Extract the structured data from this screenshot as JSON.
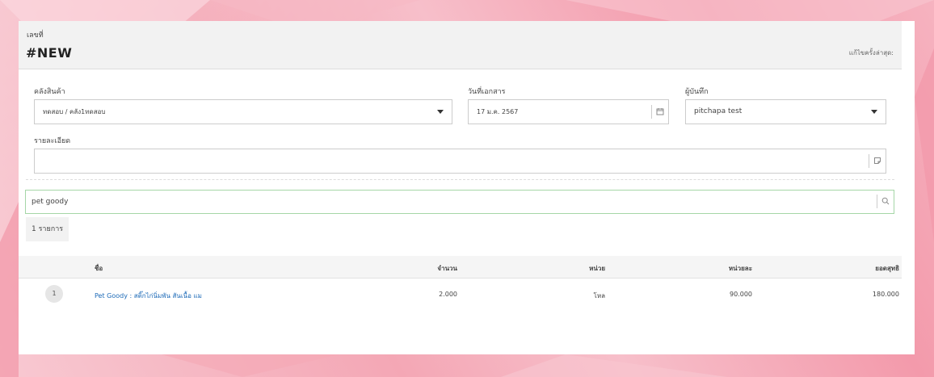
{
  "header": {
    "doc_label": "เลขที่",
    "doc_number": "#NEW",
    "last_edit_label": "แก้ไขครั้งล่าสุด:"
  },
  "form": {
    "warehouse": {
      "label": "คลังสินค้า",
      "value": "ทดสอบ / คลัง1ทดสอบ"
    },
    "doc_date": {
      "label": "วันที่เอกสาร",
      "value": "17 ม.ค. 2567"
    },
    "recorder": {
      "label": "ผู้บันทึก",
      "value": "pitchapa test"
    },
    "details": {
      "label": "รายละเอียด",
      "value": ""
    }
  },
  "search": {
    "value": "pet goody"
  },
  "result_count": "1 รายการ",
  "table": {
    "headers": {
      "name": "ชื่อ",
      "qty": "จำนวน",
      "unit": "หน่วย",
      "unit_price": "หน่วยละ",
      "total": "ยอดสุทธิ"
    },
    "rows": [
      {
        "index": "1",
        "name": "Pet Goody : สติ๊กไก่นิ่มพัน สันเนื้อ แม",
        "qty": "2.000",
        "unit": "โหล",
        "unit_price": "90.000",
        "total": "180.000"
      }
    ]
  },
  "icons": {
    "calendar": "calendar-icon",
    "note": "note-icon",
    "search": "search-icon",
    "dropdown": "caret-down-icon"
  }
}
